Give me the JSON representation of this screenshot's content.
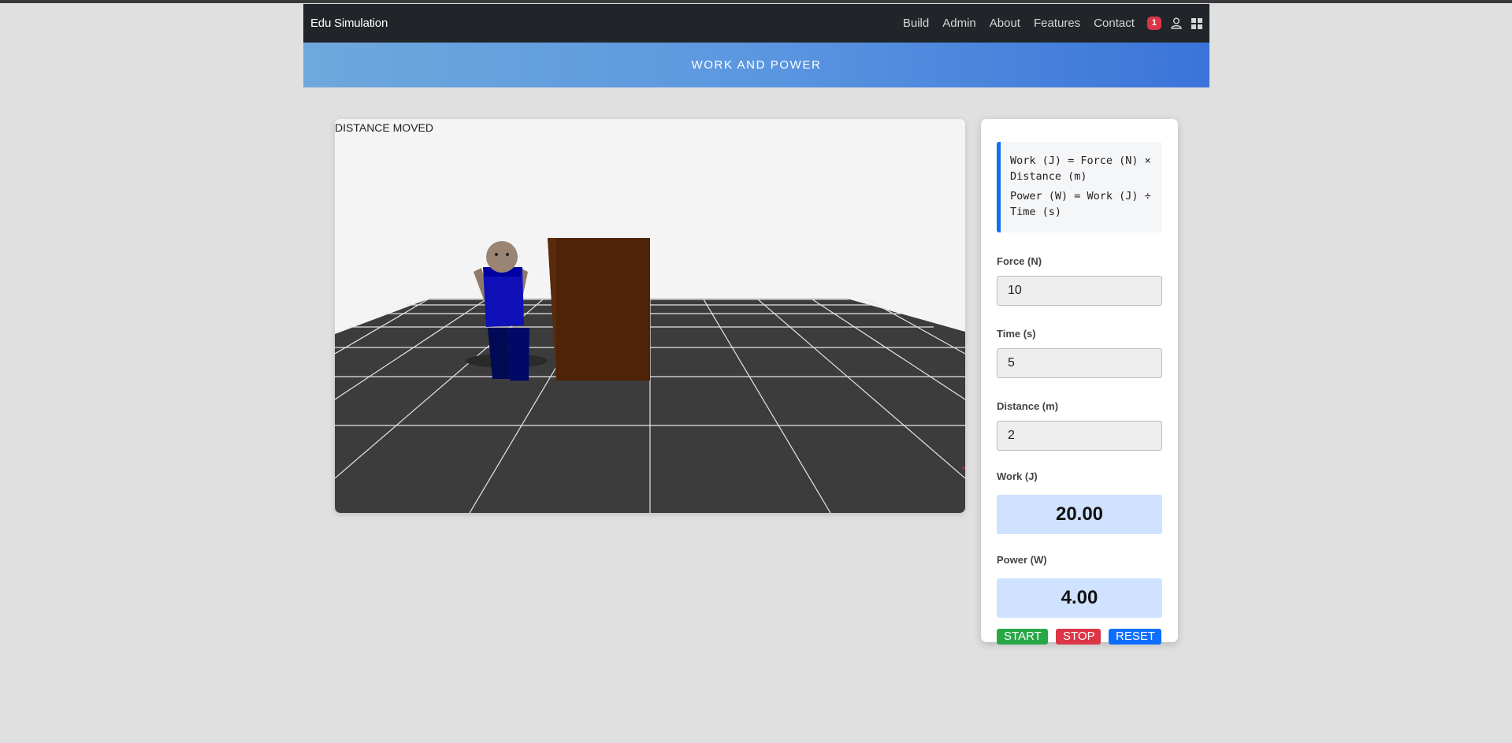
{
  "navbar": {
    "brand": "Edu Simulation",
    "links": [
      "Build",
      "Admin",
      "About",
      "Features",
      "Contact"
    ],
    "notification_count": "1",
    "icons": [
      "user-icon",
      "grid-icon"
    ]
  },
  "banner": {
    "title": "WORK AND POWER"
  },
  "simulation": {
    "label": "DISTANCE MOVED",
    "colors": {
      "floor": "#3c3c3c",
      "sky": "#f4f4f4",
      "box": "#4e2308",
      "shirt": "#0000aa",
      "pants": "#000a55"
    }
  },
  "panel": {
    "formulas": [
      "Work (J) = Force (N) × Distance (m)",
      "Power (W) = Work (J) ÷ Time (s)"
    ],
    "force": {
      "label": "Force (N)",
      "value": "10"
    },
    "time": {
      "label": "Time (s)",
      "value": "5"
    },
    "distance": {
      "label": "Distance (m)",
      "value": "2"
    },
    "work": {
      "label": "Work (J)",
      "value": "20.00"
    },
    "power": {
      "label": "Power (W)",
      "value": "4.00"
    },
    "buttons": {
      "start": "START",
      "stop": "STOP",
      "reset": "RESET"
    }
  }
}
